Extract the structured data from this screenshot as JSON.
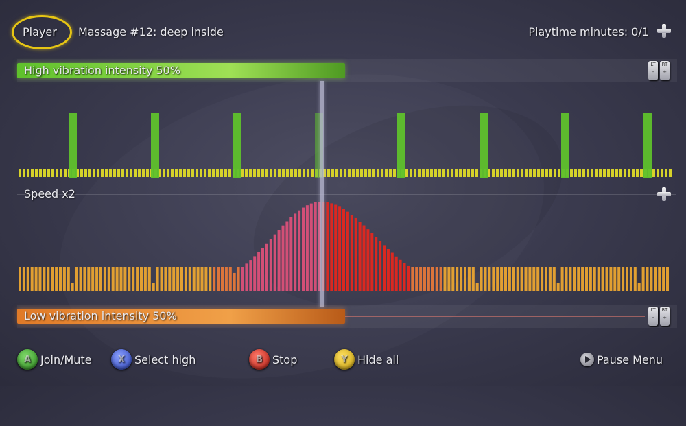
{
  "header": {
    "player_label": "Player",
    "massage_title": "Massage #12: deep inside",
    "playtime": "Playtime minutes: 0/1"
  },
  "high_bar": {
    "label": "High vibration intensity 50%",
    "level": 0.5,
    "lt": "LT",
    "rt": "RT",
    "minus": "-",
    "plus": "+"
  },
  "speed_label": "Speed x2",
  "low_bar": {
    "label": "Low vibration intensity 50%",
    "level": 0.5,
    "lt": "LT",
    "rt": "RT",
    "minus": "-",
    "plus": "+"
  },
  "footer": {
    "join_mute": "Join/Mute",
    "select_high": "Select high",
    "stop": "Stop",
    "hide_all": "Hide all",
    "pause_menu": "Pause Menu",
    "btn_a": "A",
    "btn_x": "X",
    "btn_b": "B",
    "btn_y": "Y"
  },
  "colors": {
    "accent_ring": "#e6c514",
    "high_green": "#5fc12c",
    "low_orange": "#e07a28",
    "pulse_yellow": "#d6d22a",
    "wave_orange": "#f0a830",
    "wave_pink": "#e0507a",
    "wave_red": "#e8261c"
  },
  "icons": [
    "dpad-icon",
    "lt-trigger-icon",
    "rt-trigger-icon",
    "a-button-icon",
    "x-button-icon",
    "b-button-icon",
    "y-button-icon",
    "start-button-icon"
  ]
}
